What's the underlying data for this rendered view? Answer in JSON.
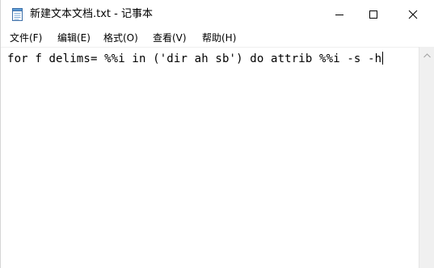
{
  "window": {
    "title": "新建文本文档.txt - 记事本"
  },
  "menu": {
    "items": [
      {
        "label": "文件(F)"
      },
      {
        "label": "编辑(E)"
      },
      {
        "label": "格式(O)"
      },
      {
        "label": "查看(V)"
      },
      {
        "label": "帮助(H)"
      }
    ]
  },
  "editor": {
    "content": "for f delims= %%i in ('dir ah sb') do attrib %%i -s -h"
  },
  "icons": {
    "app": "notepad-icon",
    "minimize": "minimize-icon",
    "maximize": "maximize-icon",
    "close": "close-icon",
    "scroll_up": "scroll-up-arrow-icon"
  },
  "colors": {
    "background": "#ffffff",
    "scrollbar": "#f0f0f0",
    "text": "#000000"
  }
}
